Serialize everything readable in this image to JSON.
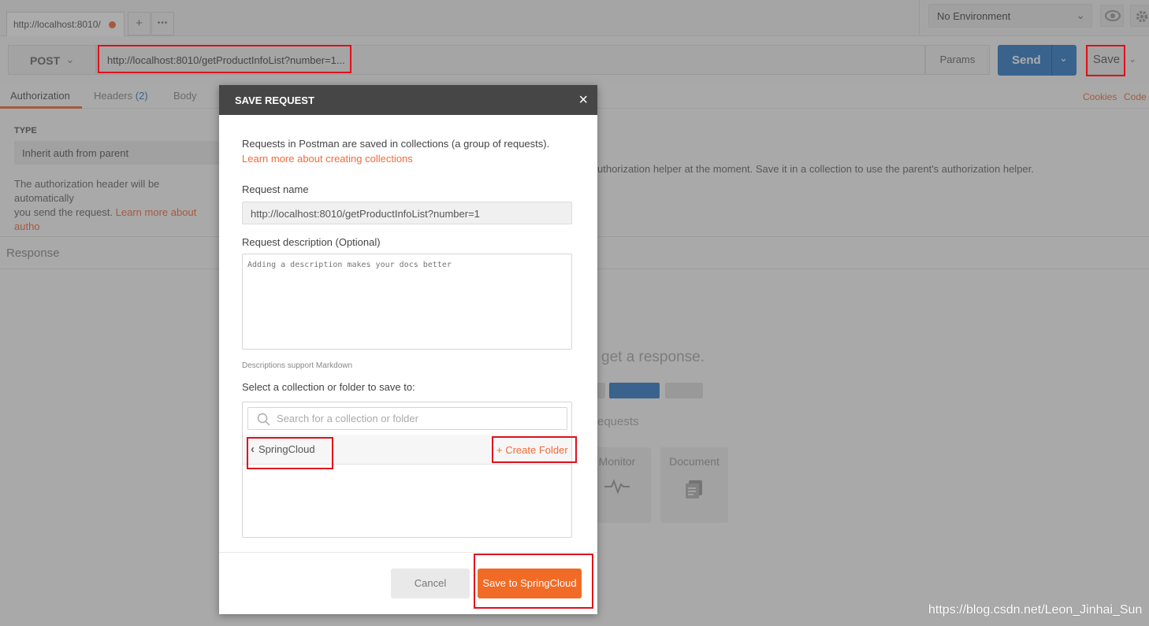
{
  "tab": {
    "title": "http://localhost:8010/",
    "new_tab": "+",
    "more": "•••"
  },
  "environment": {
    "selected": "No Environment"
  },
  "request": {
    "method": "POST",
    "url": "http://localhost:8010/getProductInfoList?number=1...",
    "params_label": "Params",
    "send_label": "Send",
    "save_label": "Save"
  },
  "subtabs": {
    "authorization": "Authorization",
    "headers": "Headers",
    "headers_count": "(2)",
    "body": "Body",
    "cookies": "Cookies",
    "code": "Code"
  },
  "auth": {
    "type_label": "TYPE",
    "type_value": "Inherit auth from parent",
    "text_line1": "The authorization header will be automatically",
    "text_line2": "you send the request.",
    "learn_more": "Learn more about autho",
    "text_right": "uthorization helper at the moment. Save it in a collection to use the parent's authorization helper."
  },
  "response": {
    "label": "Response",
    "hint": "get a response.",
    "requests_text": "equests",
    "monitor": "Monitor",
    "document": "Document"
  },
  "modal": {
    "title": "SAVE REQUEST",
    "close": "×",
    "intro": "Requests in Postman are saved in collections (a group of requests).",
    "learn_link": "Learn more about creating collections",
    "name_label": "Request name",
    "name_value": "http://localhost:8010/getProductInfoList?number=1",
    "desc_label": "Request description (Optional)",
    "desc_placeholder": "Adding a description makes your docs better",
    "markdown_note": "Descriptions support Markdown",
    "collection_label": "Select a collection or folder to save to:",
    "search_placeholder": "Search for a collection or folder",
    "back_folder": "SpringCloud",
    "create_folder": "+ Create Folder",
    "cancel": "Cancel",
    "save_to": "Save to SpringCloud"
  },
  "watermark": "https://blog.csdn.net/Leon_Jinhai_Sun",
  "colors": {
    "accent": "#f26b26",
    "primary": "#2f7bc7",
    "annotation": "#e0101b"
  }
}
